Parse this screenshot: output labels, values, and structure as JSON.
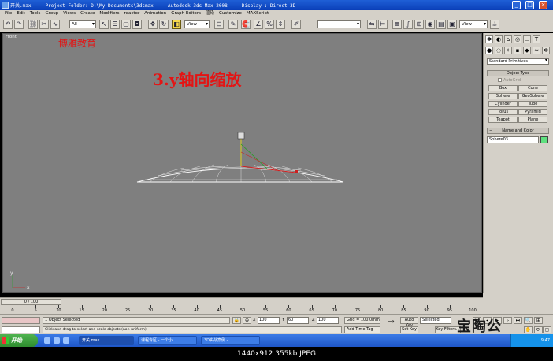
{
  "window": {
    "title": "开关.max   - Project Folder: D:\\My Documents\\3dsmax   - Autodesk 3ds Max 2008   - Display : Direct 3D",
    "controls": {
      "minimize": "_",
      "maximize": "□",
      "close": "×"
    }
  },
  "menu": [
    "File",
    "Edit",
    "Tools",
    "Group",
    "Views",
    "Create",
    "Modifiers",
    "reactor",
    "Animation",
    "Graph Editors",
    "渲染",
    "Customize",
    "MAXScript"
  ],
  "toolbar": {
    "selection_filter": "All",
    "reference_coord": "View",
    "named_selection": "",
    "render_preset": "View"
  },
  "viewport": {
    "label": "Front",
    "brand_text": "博雅教育",
    "caption": "3.y轴向缩放",
    "axis_x": "x",
    "axis_y": "y"
  },
  "command_panel": {
    "category": "Standard Primitives",
    "object_type_title": "Object Type",
    "autogrid": "AutoGrid",
    "objects": [
      "Box",
      "Cone",
      "Sphere",
      "GeoSphere",
      "Cylinder",
      "Tube",
      "Torus",
      "Pyramid",
      "Teapot",
      "Plane"
    ],
    "name_color_title": "Name and Color",
    "object_name": "Sphere03",
    "object_color": "#5fe07f"
  },
  "timeline": {
    "slider": "0 / 100",
    "ticks": [
      "0",
      "5",
      "10",
      "15",
      "20",
      "25",
      "30",
      "35",
      "40",
      "45",
      "50",
      "55",
      "60",
      "65",
      "70",
      "75",
      "80",
      "85",
      "90",
      "95",
      "100"
    ]
  },
  "status": {
    "selection": "1 Object Selected",
    "prompt": "Click and drag to select and scale objects (non-uniform)",
    "x_label": "X",
    "x_value": "100",
    "y_label": "Y",
    "y_value": "60",
    "z_label": "Z",
    "z_value": "100",
    "grid": "Grid = 100.0mm",
    "add_time_tag": "Add Time Tag",
    "auto_key": "Auto Key",
    "set_key": "Set Key",
    "key_mode": "Selected",
    "key_filters": "Key Filters..."
  },
  "taskbar": {
    "start": "开始",
    "tasks": [
      "开关.max",
      "课程专区 - 一个小...",
      "3D实战案例 - ..."
    ],
    "clock": "9:47"
  },
  "watermark": "宝陶公",
  "footer": "1440x912  355kb  JPEG"
}
